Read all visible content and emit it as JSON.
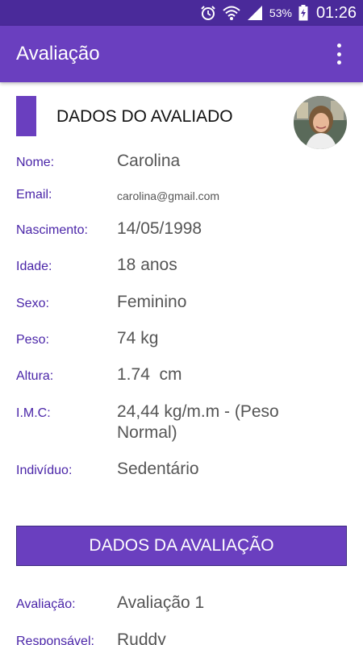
{
  "status_bar": {
    "battery_percent": "53%",
    "time": "01:26",
    "icons": [
      "alarm-icon",
      "wifi-icon",
      "signal-icon",
      "battery-charging-icon"
    ]
  },
  "app_bar": {
    "title": "Avaliação",
    "menu_icon": "overflow-menu-icon"
  },
  "avaliado": {
    "title": "DADOS DO AVALIADO",
    "fields": [
      {
        "label": "Nome:",
        "value": "Carolina"
      },
      {
        "label": "Email:",
        "value": "carolina@gmail.com"
      },
      {
        "label": "Nascimento:",
        "value": "14/05/1998"
      },
      {
        "label": "Idade:",
        "value": "18 anos"
      },
      {
        "label": "Sexo:",
        "value": "Feminino"
      },
      {
        "label": "Peso:",
        "value": "74 kg"
      },
      {
        "label": "Altura:",
        "value": "1.74  cm"
      },
      {
        "label": "I.M.C:",
        "value": "24,44 kg/m.m - (Peso Normal)"
      },
      {
        "label": "Indivíduo:",
        "value": "Sedentário"
      }
    ]
  },
  "avaliacao": {
    "title": "DADOS DA AVALIAÇÃO",
    "fields": [
      {
        "label": "Avaliação:",
        "value": "Avaliação 1"
      },
      {
        "label": "Responsável:",
        "value": "Ruddy"
      }
    ]
  },
  "colors": {
    "status_bar": "#4a2a9a",
    "primary": "#6a3fbf",
    "label_text": "#4a25a8",
    "value_text": "#555555"
  }
}
